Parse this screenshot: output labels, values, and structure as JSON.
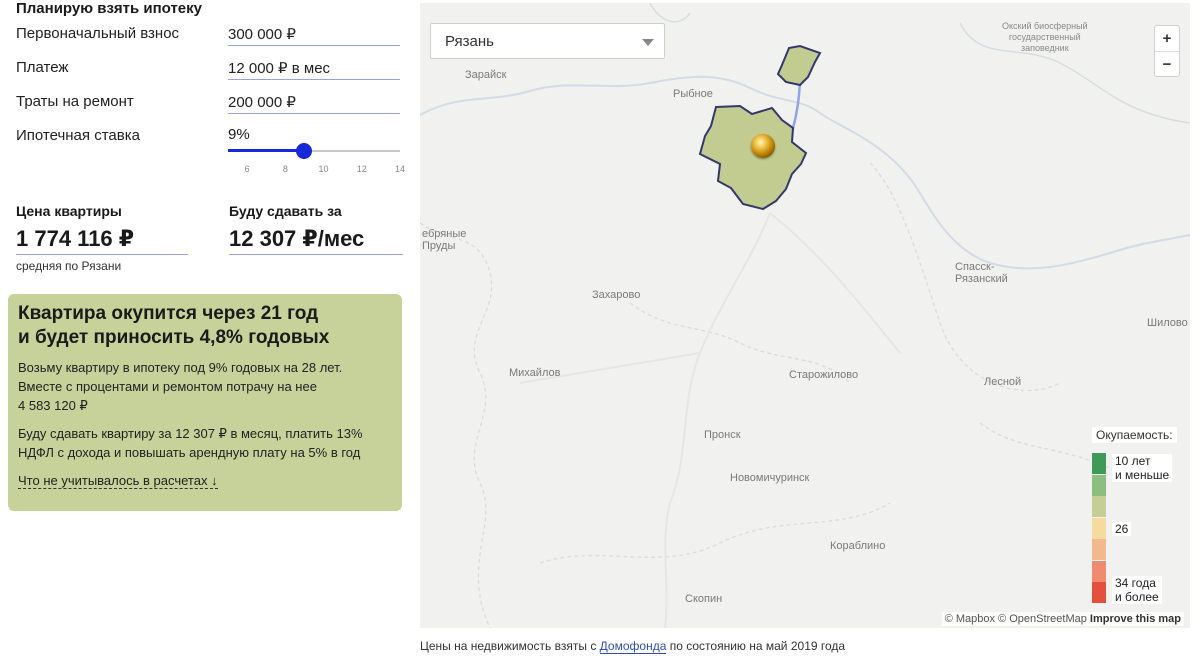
{
  "calculator": {
    "heading": "Планирую взять ипотеку",
    "down_payment": {
      "label": "Первоначальный взнос",
      "value": "300 000 ₽"
    },
    "payment": {
      "label": "Платеж",
      "value": "12 000 ₽ в мес"
    },
    "renovation": {
      "label": "Траты на ремонт",
      "value": "200 000 ₽"
    },
    "rate": {
      "label": "Ипотечная ставка",
      "value": "9%",
      "current": 9,
      "min": 5,
      "max": 14,
      "ticks": [
        "6",
        "8",
        "10",
        "12",
        "14"
      ],
      "tick_values": [
        6,
        8,
        10,
        12,
        14
      ]
    }
  },
  "results": {
    "price_label": "Цена квартиры",
    "price_value": "1 774 116 ₽",
    "price_sub": "средняя по Рязани",
    "rent_label": "Буду сдавать за",
    "rent_value": "12 307 ₽/мес"
  },
  "summary": {
    "headline_line1": "Квартира окупится через 21 год",
    "headline_line2": "и будет приносить 4,8% годовых",
    "para1_line1": "Возьму квартиру в ипотеку под 9% годовых на 28 лет.",
    "para1_line2": "Вместе с процентами и ремонтом потрачу на нее",
    "para1_line3": "4 583 120 ₽",
    "para2_line1": "Буду сдавать квартиру за 12 307 ₽ в месяц, платить 13%",
    "para2_line2": "НДФЛ с дохода и повышать арендную плату на 5% в год",
    "more_link": "Что не учитывалось в расчетах ↓"
  },
  "map": {
    "region_select": "Рязань",
    "zoom_in": "+",
    "zoom_out": "−",
    "places": {
      "zaraysk": "Зарайск",
      "rybnoe": "Рыбное",
      "oksky_1": "Окский биосферный",
      "oksky_2": "государственный",
      "oksky_3": "заповедник",
      "serebryanye_1": "ебряные",
      "serebryanye_2": "Пруды",
      "spassk_1": "Спасск-",
      "spassk_2": "Рязанский",
      "zakharovo": "Захарово",
      "shilovo": "Шилово",
      "mikhaylov": "Михайлов",
      "starozhilovo": "Старожилово",
      "lesnoy": "Лесной",
      "pronsk": "Пронск",
      "novomichurinsk": "Новомичуринск",
      "korablino": "Кораблино",
      "skopin": "Скопин"
    },
    "legend": {
      "title": "Окупаемость:",
      "top_label_1": "10 лет",
      "top_label_2": "и меньше",
      "mid_label": "26",
      "bottom_label_1": "34 года",
      "bottom_label_2": "и более",
      "colors": [
        "#3f9a5a",
        "#8cbf7e",
        "#c5cf95",
        "#f6dba0",
        "#f3b98e",
        "#ee8b70",
        "#e5503c"
      ]
    },
    "attribution_1": "© Mapbox © OpenStreetMap",
    "attribution_2": "Improve this map",
    "region_fill": "#c2cc90",
    "region_stroke": "#33386b"
  },
  "source": {
    "prefix": "Цены на недвижимость взяты с",
    "link": "Домофонда",
    "suffix": "по состоянию на май 2019 года"
  }
}
